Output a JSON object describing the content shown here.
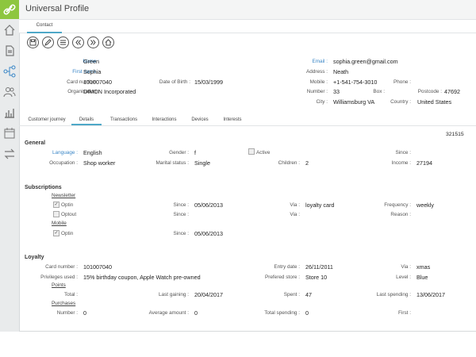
{
  "app": {
    "title": "Universal Profile"
  },
  "tabs_top": {
    "contact": "Contact"
  },
  "contact": {
    "name_label": "Name :",
    "name": "Green",
    "firstname_label": "First name :",
    "firstname": "Sophia",
    "card_label": "Card number :",
    "card": "101007040",
    "dob_label": "Date of Birth :",
    "dob": "15/03/1999",
    "org_label": "Organisation :",
    "org": "DIMON Incorporated",
    "email_label": "Email :",
    "email": "sophia.green@gmail.com",
    "address_label": "Address :",
    "address": "Neath",
    "mobile_label": "Mobile :",
    "mobile": "+1-541-754-3010",
    "phone_label": "Phone :",
    "number_label": "Number :",
    "number": "33",
    "box_label": "Box :",
    "postcode_label": "Postcode :",
    "postcode": "47692",
    "city_label": "City :",
    "city": "Williamsburg VA",
    "country_label": "Country :",
    "country": "United States"
  },
  "tabs": {
    "journey": "Customer journey",
    "details": "Details",
    "transactions": "Transactions",
    "interactions": "Interactions",
    "devices": "Devices",
    "interests": "Interests"
  },
  "id_corner": "321515",
  "general": {
    "title": "General",
    "language_label": "Language :",
    "language": "English",
    "gender_label": "Gender :",
    "gender": "f",
    "active_label": "Active",
    "since_label": "Since :",
    "occupation_label": "Occupation :",
    "occupation": "Shop worker",
    "marital_label": "Marital status :",
    "marital": "Single",
    "children_label": "Children :",
    "children": "2",
    "income_label": "Income :",
    "income": "27194"
  },
  "subscriptions": {
    "title": "Subscriptions",
    "newsletter": "Newsletter",
    "optin_label": "Optin",
    "optout_label": "Optout",
    "mobile": "Mobile",
    "since_label": "Since :",
    "via_label": "Via :",
    "frequency_label": "Frequency :",
    "reason_label": "Reason :",
    "newsletter_since": "05/06/2013",
    "newsletter_via": "loyalty card",
    "newsletter_frequency": "weekly",
    "mobile_since": "05/06/2013"
  },
  "loyalty": {
    "title": "Loyalty",
    "card_label": "Card number :",
    "card": "101007040",
    "entry_label": "Entry date :",
    "entry": "26/11/2011",
    "via_label": "Via :",
    "via": "xmas",
    "priv_label": "Privileges used :",
    "priv": "15% birthday coupon, Apple Watch pre-owned",
    "store_label": "Prefered store :",
    "store": "Store 10",
    "level_label": "Level :",
    "level": "Blue",
    "points": "Points",
    "total_label": "Total :",
    "last_gaining_label": "Last gaining :",
    "last_gaining": "20/04/2017",
    "spent_label": "Spent :",
    "spent": "47",
    "last_spending_label": "Last spending :",
    "last_spending": "13/06/2017",
    "purchases": "Purchases",
    "pnumber_label": "Number :",
    "pnumber": "0",
    "avg_label": "Average amount :",
    "avg": "0",
    "total_spending_label": "Total spending :",
    "total_spending": "0",
    "first_label": "First :"
  }
}
